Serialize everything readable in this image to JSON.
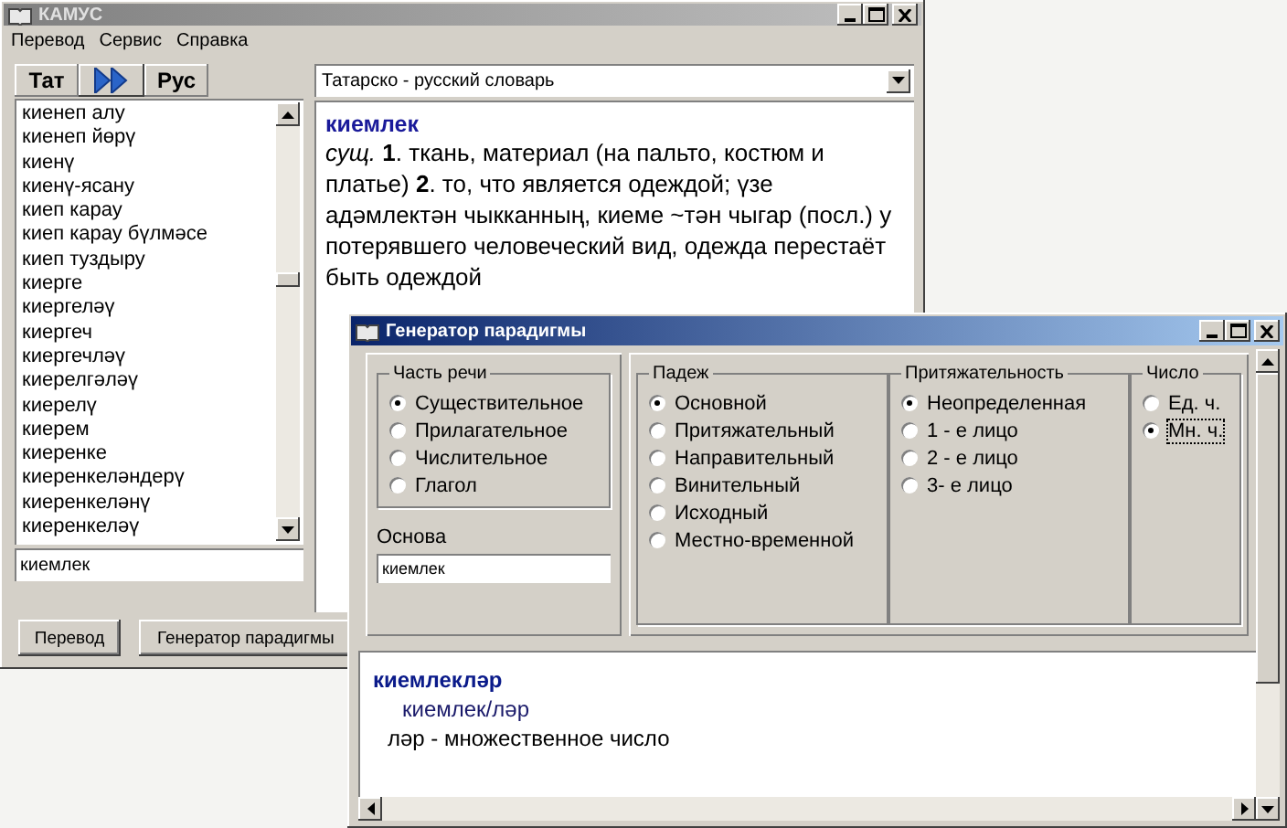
{
  "main_window": {
    "title": "КАМУС",
    "active": false,
    "menu": [
      "Перевод",
      "Сервис",
      "Справка"
    ],
    "lang_from": "Тат",
    "lang_to": "Рус",
    "dictionary": "Татарско - русский словарь",
    "word_list": [
      "киенеп алу",
      "киенеп йөрү",
      "киенү",
      "киенү-ясану",
      "киеп карау",
      "киеп карау бүлмәсе",
      "киеп туздыру",
      "киерге",
      "киергеләү",
      "киергеч",
      "киергечләү",
      "киерелгәләү",
      "киерелү",
      "киерем",
      "киеренке",
      "киеренкеләндерү",
      "киеренкеләнү",
      "киеренкеләү"
    ],
    "search_value": "киемлек",
    "entry": {
      "headword": "киемлек",
      "definition": " *сущ.* **1**. ткань, материал (на пальто, костюм и платье) **2**. то, что является одеждой; үзе адәмлектән чыкканның, киеме ~тән чыгар (посл.) у потерявшего человеческий вид, одежда перестаёт быть одеждой"
    },
    "buttons": [
      "Перевод",
      "Генератор парадигмы"
    ]
  },
  "paradigm_window": {
    "title": "Генератор парадигмы",
    "active": true,
    "groups": [
      {
        "title": "Часть речи",
        "options": [
          {
            "label": "Существительное",
            "selected": true
          },
          {
            "label": "Прилагательное",
            "selected": false
          },
          {
            "label": "Числительное",
            "selected": false
          },
          {
            "label": "Глагол",
            "selected": false
          }
        ]
      },
      {
        "title": "Падеж",
        "options": [
          {
            "label": "Основной",
            "selected": true
          },
          {
            "label": "Притяжательный",
            "selected": false
          },
          {
            "label": "Направительный",
            "selected": false
          },
          {
            "label": "Винительный",
            "selected": false
          },
          {
            "label": "Исходный",
            "selected": false
          },
          {
            "label": "Местно-временной",
            "selected": false
          }
        ]
      },
      {
        "title": "Притяжательность",
        "options": [
          {
            "label": "Неопределенная",
            "selected": true
          },
          {
            "label": "1 - е лицо",
            "selected": false
          },
          {
            "label": "2 - е лицо",
            "selected": false
          },
          {
            "label": "3- е лицо",
            "selected": false
          }
        ]
      },
      {
        "title": "Число",
        "options": [
          {
            "label": "Ед. ч.",
            "selected": false
          },
          {
            "label": "Мн. ч.",
            "selected": true
          }
        ]
      }
    ],
    "base_label": "Основа",
    "base_value": "киемлек",
    "result": [
      {
        "kind": "word",
        "text": "киемлекләр"
      },
      {
        "kind": "split",
        "text": "киемлек/ләр"
      },
      {
        "kind": "gloss",
        "text": "ләр - множественное число"
      }
    ]
  }
}
